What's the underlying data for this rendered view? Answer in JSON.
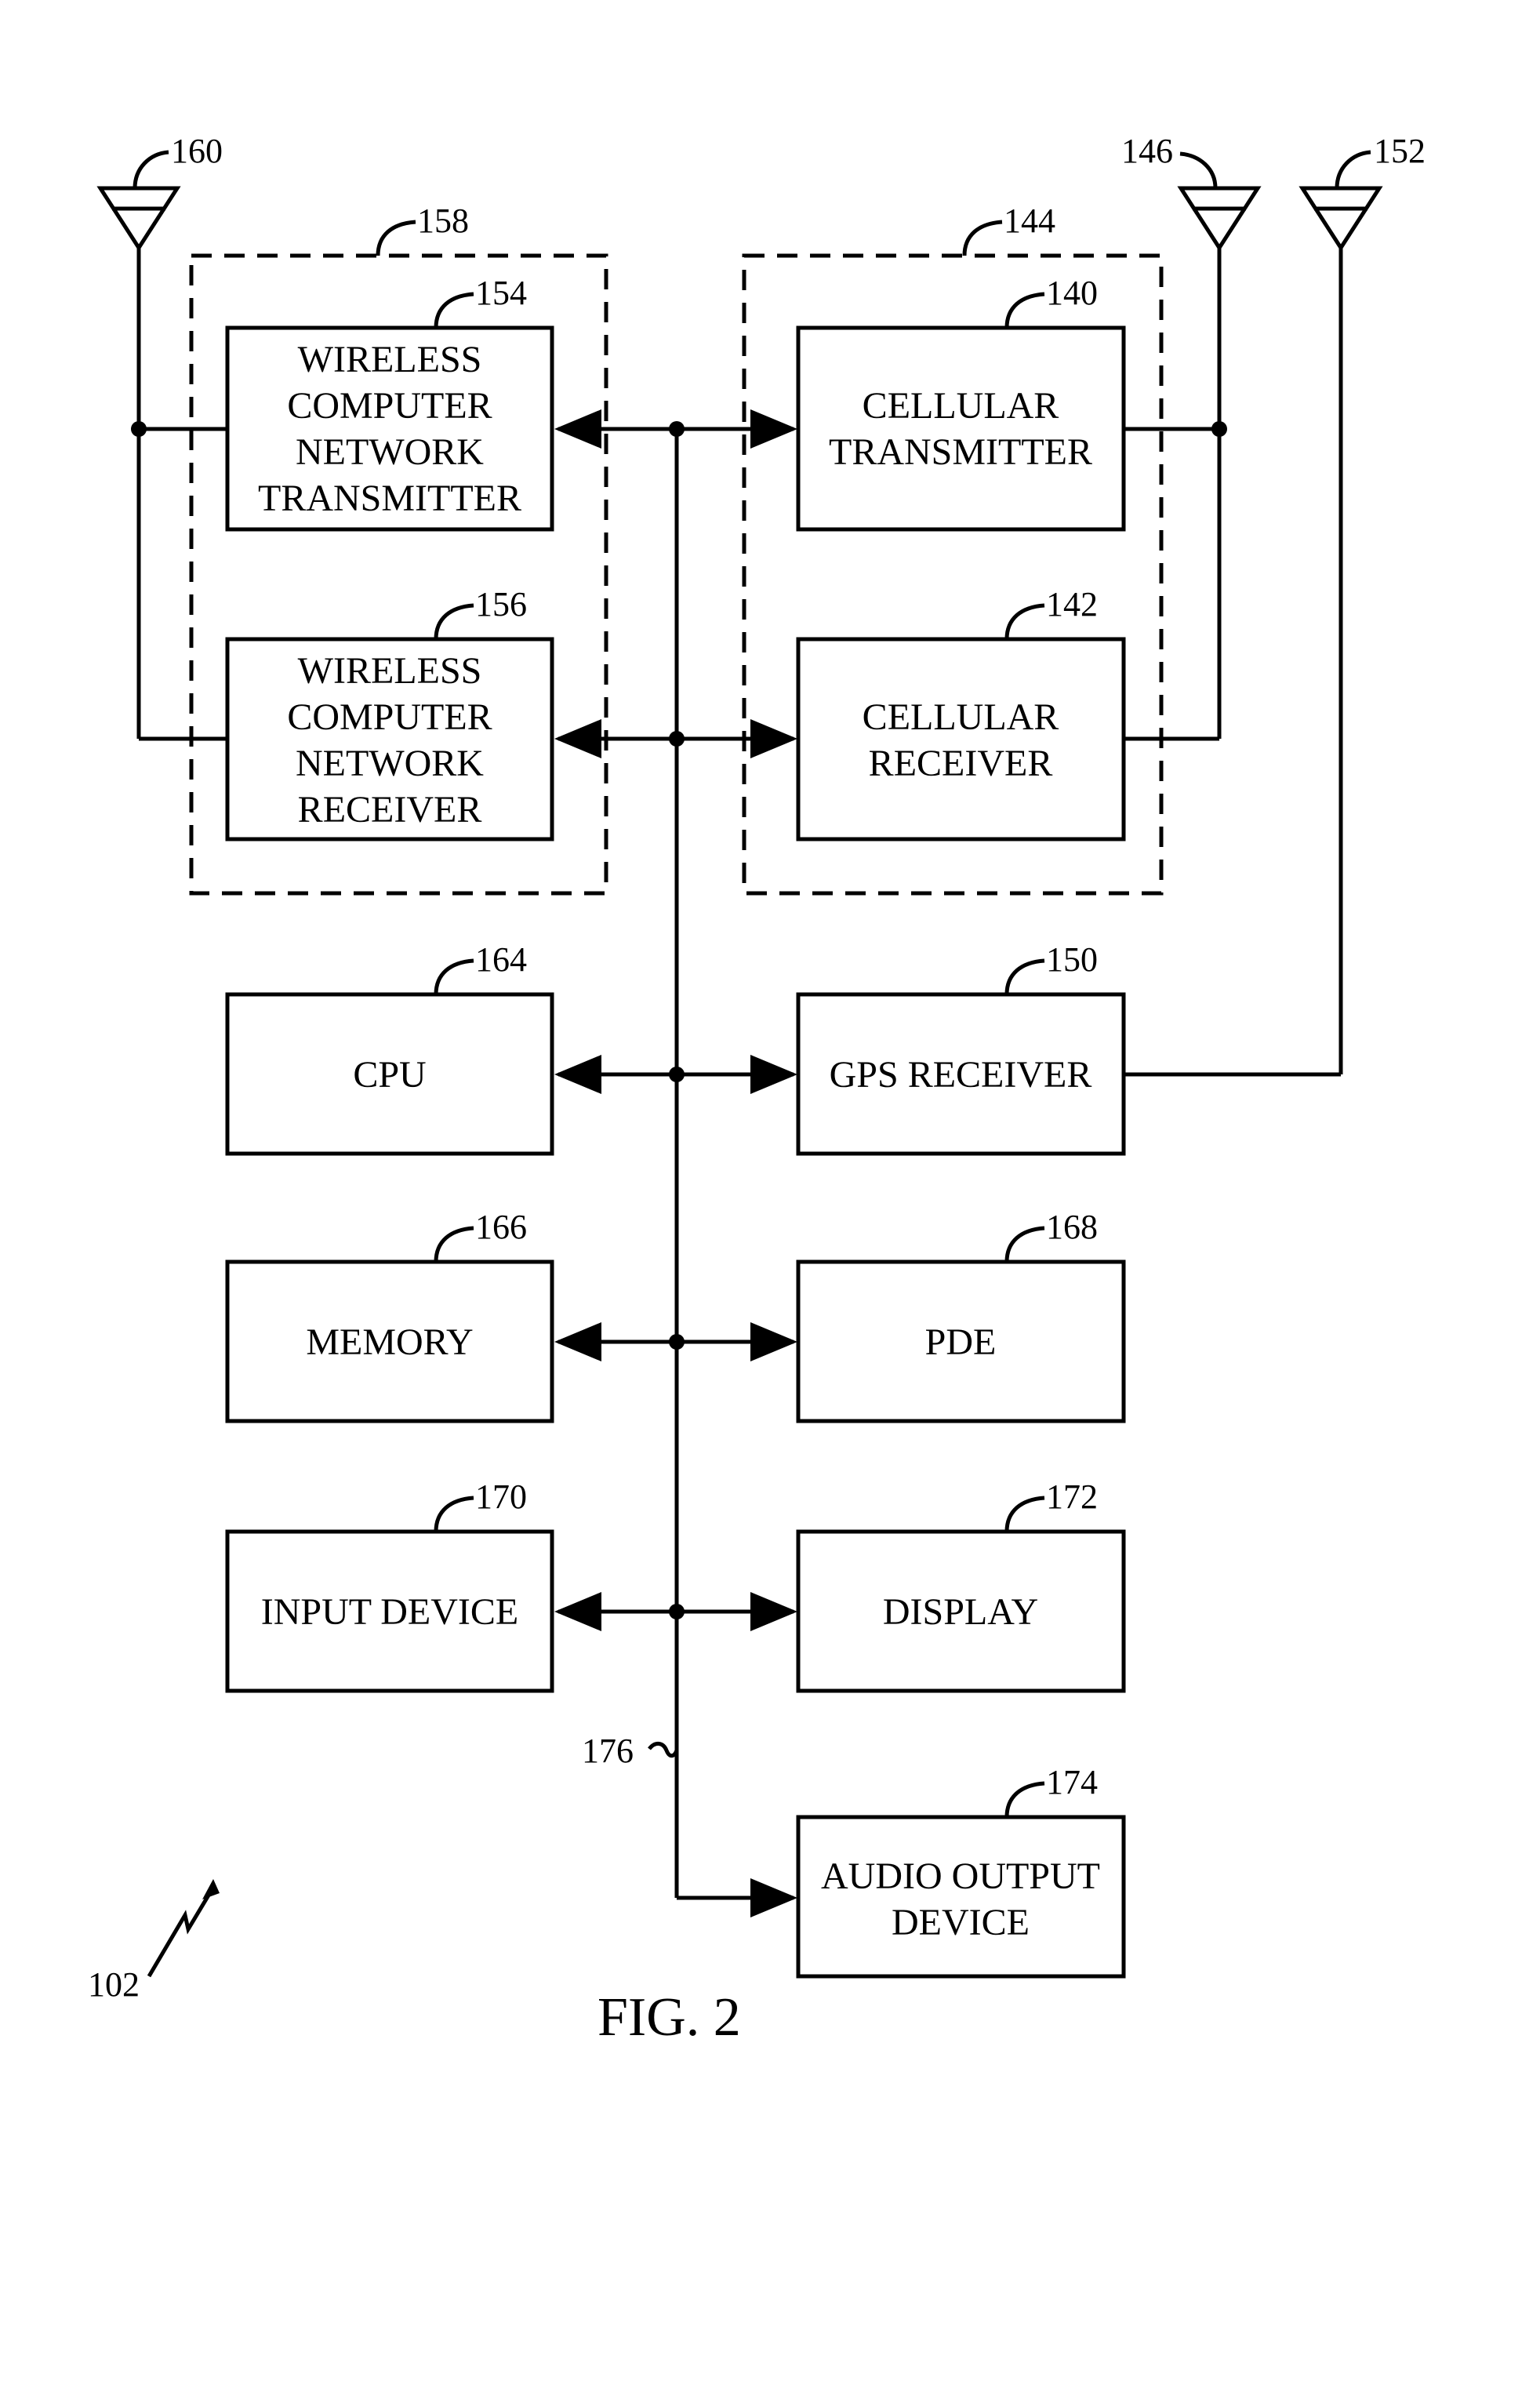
{
  "figure": {
    "caption": "FIG. 2",
    "device_ref": "102",
    "bus_ref": "176"
  },
  "groups": {
    "wireless_network": {
      "ref": "158"
    },
    "cellular": {
      "ref": "144"
    }
  },
  "antennas": {
    "wireless": {
      "ref": "160"
    },
    "cellular": {
      "ref": "146"
    },
    "gps": {
      "ref": "152"
    }
  },
  "blocks": {
    "wcn_tx": {
      "ref": "154",
      "lines": [
        "WIRELESS",
        "COMPUTER",
        "NETWORK",
        "TRANSMITTER"
      ]
    },
    "wcn_rx": {
      "ref": "156",
      "lines": [
        "WIRELESS",
        "COMPUTER",
        "NETWORK",
        "RECEIVER"
      ]
    },
    "cell_tx": {
      "ref": "140",
      "lines": [
        "CELLULAR",
        "TRANSMITTER"
      ]
    },
    "cell_rx": {
      "ref": "142",
      "lines": [
        "CELLULAR",
        "RECEIVER"
      ]
    },
    "cpu": {
      "ref": "164",
      "lines": [
        "CPU"
      ]
    },
    "gps": {
      "ref": "150",
      "lines": [
        "GPS RECEIVER"
      ]
    },
    "memory": {
      "ref": "166",
      "lines": [
        "MEMORY"
      ]
    },
    "pde": {
      "ref": "168",
      "lines": [
        "PDE"
      ]
    },
    "input": {
      "ref": "170",
      "lines": [
        "INPUT DEVICE"
      ]
    },
    "display": {
      "ref": "172",
      "lines": [
        "DISPLAY"
      ]
    },
    "audio": {
      "ref": "174",
      "lines": [
        "AUDIO OUTPUT",
        "DEVICE"
      ]
    }
  }
}
